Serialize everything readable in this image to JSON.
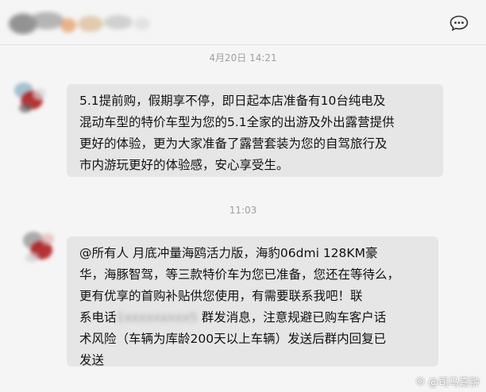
{
  "header": {
    "title": "",
    "more_icon": "chat-more-icon"
  },
  "messages": [
    {
      "timestamp": "4月20日 14:21",
      "lines": [
        "5.1提前购，假期享不停，即日起本店准备有10台纯电及",
        "混动车型的特价车型为您的5.1全家的出游及外出露营提供",
        "更好的体验，更为大家准备了露营套装为您的自驾旅行及",
        "市内游玩更好的体验感，安心享受生。"
      ]
    },
    {
      "timestamp": "11:03",
      "lines": [
        "@所有人 月底冲量海鸥活力版，海豹06dmi 128KM豪",
        "华，海豚智驾，等三款特价车为您已准备，您还在等待么，",
        "更有优享的首购补贴供您使用，有需要联系我吧！联",
        "术风险（车辆为库龄200天以上车辆）发送后群内回复已",
        "发送"
      ],
      "line4_visible_prefix": "系电话",
      "line4_blurred": "1xxxxxxxxx5",
      "line4_visible_suffix": " 群发消息，注意规避已购车客户话"
    }
  ],
  "watermark": "@司马嘉翀",
  "colors": {
    "background": "#f5f5f5",
    "bubble": "#e6e6e6",
    "timestamp": "#a0a0a0",
    "text": "#111111"
  }
}
